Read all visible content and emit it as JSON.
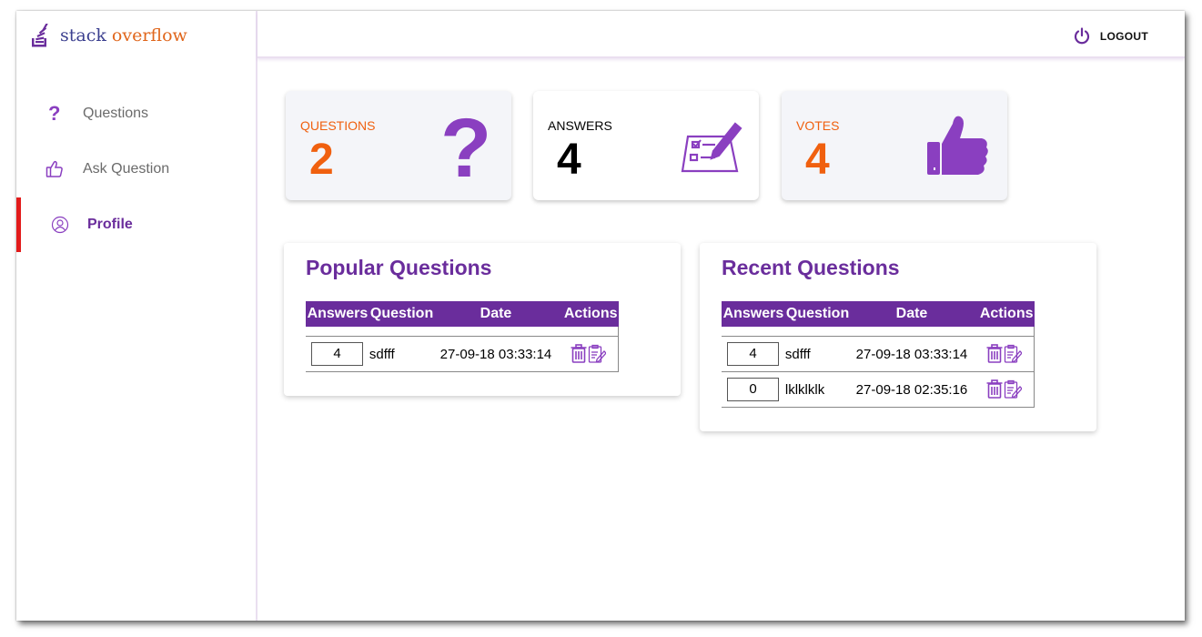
{
  "brand": {
    "stack": "stack",
    "overflow": "overflow"
  },
  "sidebar": {
    "items": [
      {
        "label": "Questions",
        "icon": "question-icon"
      },
      {
        "label": "Ask Question",
        "icon": "thumbs-up-icon"
      },
      {
        "label": "Profile",
        "icon": "user-circle-icon",
        "active": true
      }
    ]
  },
  "header": {
    "logout_label": "LOGOUT"
  },
  "stats": {
    "questions": {
      "label": "QUESTIONS",
      "value": "2"
    },
    "answers": {
      "label": "ANSWERS",
      "value": "4"
    },
    "votes": {
      "label": "VOTES",
      "value": "4"
    }
  },
  "columns": [
    "Answers",
    "Question",
    "Date",
    "Actions"
  ],
  "popular": {
    "title": "Popular Questions",
    "rows": [
      {
        "answers": "4",
        "question": "sdfff",
        "date": "27-09-18 03:33:14"
      }
    ]
  },
  "recent": {
    "title": "Recent Questions",
    "rows": [
      {
        "answers": "4",
        "question": "sdfff",
        "date": "27-09-18 03:33:14"
      },
      {
        "answers": "0",
        "question": "lklklklk",
        "date": "27-09-18 02:35:16"
      }
    ]
  },
  "colors": {
    "accent": "#6a2d9c",
    "orange": "#f0600f",
    "active_bar": "#e21a1a"
  }
}
